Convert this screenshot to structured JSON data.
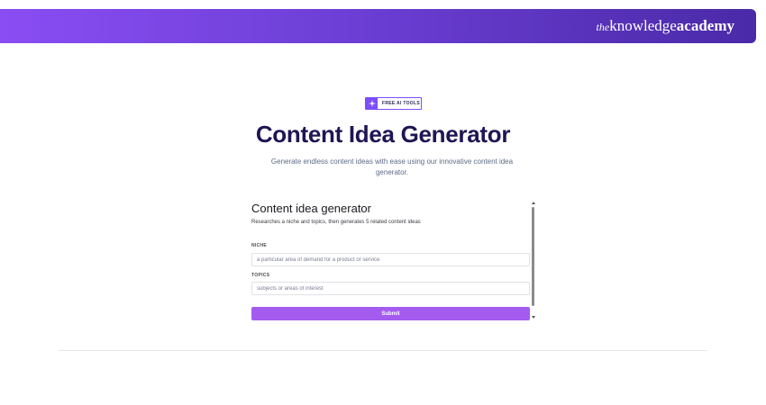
{
  "header": {
    "logo_prefix": "the",
    "logo_knowledge": "knowledge",
    "logo_academy": "academy",
    "gradient": [
      "#8a4df3",
      "#4a2aa8"
    ]
  },
  "hero": {
    "badge_icon": "sparkle-icon",
    "badge_label": "FREE AI TOOLS",
    "title": "Content Idea Generator",
    "subtitle": "Generate endless content ideas with ease using our innovative content idea generator."
  },
  "tool": {
    "title": "Content idea generator",
    "description": "Researches a niche and topics, then generates 5 related content ideas",
    "fields": [
      {
        "label": "NICHE",
        "value": "",
        "placeholder": "a particular area of demand for a product or service"
      },
      {
        "label": "TOPICS",
        "value": "",
        "placeholder": "subjects or areas of interest"
      }
    ],
    "submit_label": "Submit",
    "accent": "#a45cf0"
  }
}
